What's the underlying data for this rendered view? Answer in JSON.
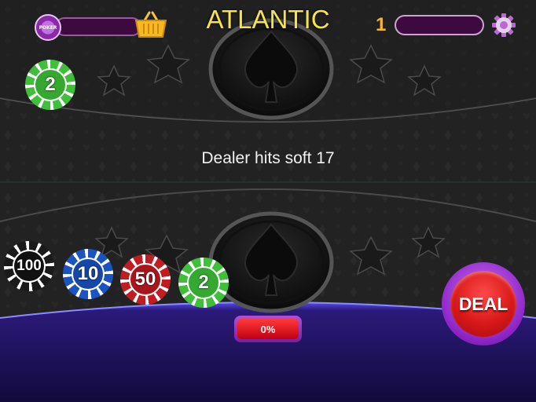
{
  "header": {
    "chip_badge_label": "POKER",
    "title": "ATLANTIC",
    "level": "1",
    "basket_icon": "basket-icon",
    "settings_icon": "gear-icon"
  },
  "table": {
    "rule_text": "Dealer hits soft 17",
    "dealer_chip": {
      "value": "2",
      "color": "#3fbf3a"
    }
  },
  "chips": [
    {
      "value": "100",
      "color": "#1a1a1a"
    },
    {
      "value": "10",
      "color": "#1a54c4"
    },
    {
      "value": "50",
      "color": "#c01c22"
    },
    {
      "value": "2",
      "color": "#3fbf3a"
    }
  ],
  "progress": {
    "label": "0%",
    "value": 0
  },
  "deal_button": {
    "label": "DEAL"
  },
  "colors": {
    "title": "#f6e24a",
    "accent_purple": "#8b24c4",
    "deal_red": "#d81818",
    "table_glow": "#4a36e0"
  }
}
